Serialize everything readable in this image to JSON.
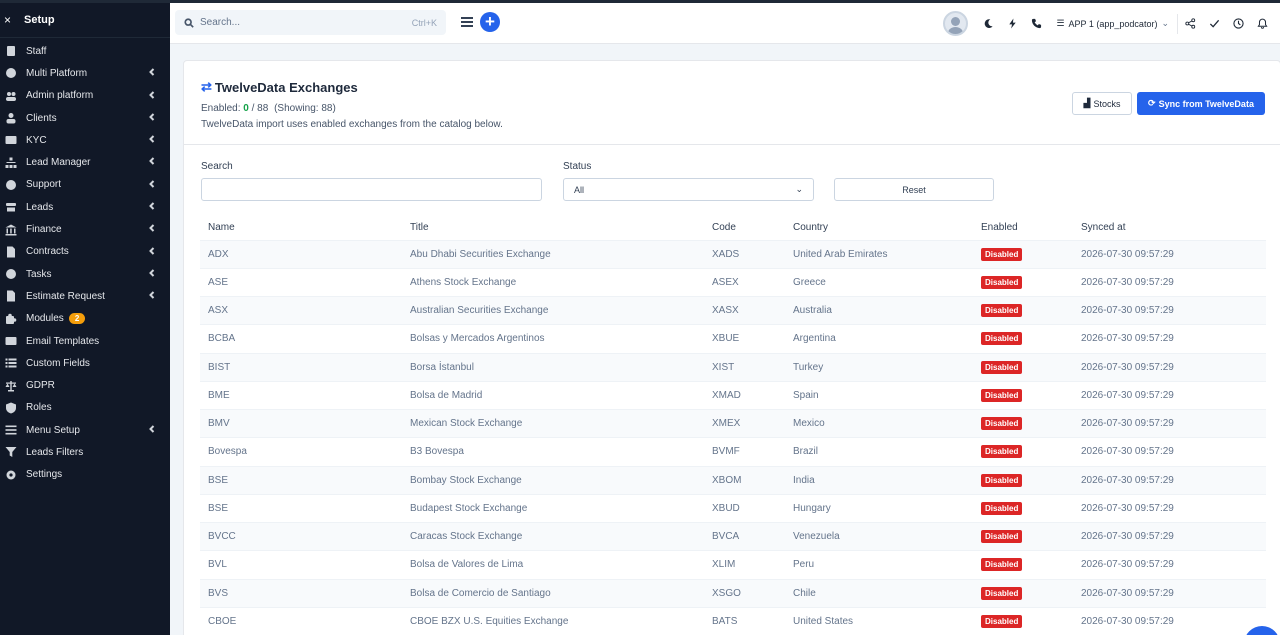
{
  "sidebar": {
    "close_glyph": "×",
    "title": "Setup",
    "items": [
      {
        "label": "Staff",
        "icon": "staff-icon",
        "chevron": false
      },
      {
        "label": "Multi Platform",
        "icon": "globe-icon",
        "chevron": true
      },
      {
        "label": "Admin platform",
        "icon": "users-icon",
        "chevron": true
      },
      {
        "label": "Clients",
        "icon": "user-icon",
        "chevron": true
      },
      {
        "label": "KYC",
        "icon": "id-card-icon",
        "chevron": true
      },
      {
        "label": "Lead Manager",
        "icon": "sitemap-icon",
        "chevron": true
      },
      {
        "label": "Support",
        "icon": "life-ring-icon",
        "chevron": true
      },
      {
        "label": "Leads",
        "icon": "tty-icon",
        "chevron": true
      },
      {
        "label": "Finance",
        "icon": "bank-icon",
        "chevron": true
      },
      {
        "label": "Contracts",
        "icon": "file-icon",
        "chevron": true
      },
      {
        "label": "Tasks",
        "icon": "check-circle-icon",
        "chevron": true
      },
      {
        "label": "Estimate Request",
        "icon": "file-outline-icon",
        "chevron": true
      },
      {
        "label": "Modules",
        "icon": "puzzle-icon",
        "chevron": false,
        "badge": "2"
      },
      {
        "label": "Email Templates",
        "icon": "envelope-icon",
        "chevron": false
      },
      {
        "label": "Custom Fields",
        "icon": "list-icon",
        "chevron": false
      },
      {
        "label": "GDPR",
        "icon": "scale-icon",
        "chevron": false
      },
      {
        "label": "Roles",
        "icon": "shield-icon",
        "chevron": false
      },
      {
        "label": "Menu Setup",
        "icon": "bars-icon",
        "chevron": true
      },
      {
        "label": "Leads Filters",
        "icon": "filter-icon",
        "chevron": false
      },
      {
        "label": "Settings",
        "icon": "gear-icon",
        "chevron": false
      }
    ]
  },
  "topbar": {
    "search_placeholder": "Search...",
    "search_shortcut": "Ctrl+K",
    "app_selector": "APP 1 (app_podcator)"
  },
  "page": {
    "title": "TwelveData Exchanges",
    "enabled_label": "Enabled:",
    "enabled_count": "0",
    "enabled_total": "/ 88",
    "showing": "(Showing: 88)",
    "description": "TwelveData import uses enabled exchanges from the catalog below.",
    "stocks_button": "Stocks",
    "sync_button": "Sync from TwelveData"
  },
  "filters": {
    "search_label": "Search",
    "search_value": "",
    "status_label": "Status",
    "status_value": "All",
    "reset_button": "Reset"
  },
  "table": {
    "headers": [
      "Name",
      "Title",
      "Code",
      "Country",
      "Enabled",
      "Synced at"
    ],
    "rows": [
      {
        "name": "ADX",
        "title": "Abu Dhabi Securities Exchange",
        "code": "XADS",
        "country": "United Arab Emirates",
        "enabled": "Disabled",
        "synced": "2026-07-30 09:57:29"
      },
      {
        "name": "ASE",
        "title": "Athens Stock Exchange",
        "code": "ASEX",
        "country": "Greece",
        "enabled": "Disabled",
        "synced": "2026-07-30 09:57:29"
      },
      {
        "name": "ASX",
        "title": "Australian Securities Exchange",
        "code": "XASX",
        "country": "Australia",
        "enabled": "Disabled",
        "synced": "2026-07-30 09:57:29"
      },
      {
        "name": "BCBA",
        "title": "Bolsas y Mercados Argentinos",
        "code": "XBUE",
        "country": "Argentina",
        "enabled": "Disabled",
        "synced": "2026-07-30 09:57:29"
      },
      {
        "name": "BIST",
        "title": "Borsa İstanbul",
        "code": "XIST",
        "country": "Turkey",
        "enabled": "Disabled",
        "synced": "2026-07-30 09:57:29"
      },
      {
        "name": "BME",
        "title": "Bolsa de Madrid",
        "code": "XMAD",
        "country": "Spain",
        "enabled": "Disabled",
        "synced": "2026-07-30 09:57:29"
      },
      {
        "name": "BMV",
        "title": "Mexican Stock Exchange",
        "code": "XMEX",
        "country": "Mexico",
        "enabled": "Disabled",
        "synced": "2026-07-30 09:57:29"
      },
      {
        "name": "Bovespa",
        "title": "B3 Bovespa",
        "code": "BVMF",
        "country": "Brazil",
        "enabled": "Disabled",
        "synced": "2026-07-30 09:57:29"
      },
      {
        "name": "BSE",
        "title": "Bombay Stock Exchange",
        "code": "XBOM",
        "country": "India",
        "enabled": "Disabled",
        "synced": "2026-07-30 09:57:29"
      },
      {
        "name": "BSE",
        "title": "Budapest Stock Exchange",
        "code": "XBUD",
        "country": "Hungary",
        "enabled": "Disabled",
        "synced": "2026-07-30 09:57:29"
      },
      {
        "name": "BVCC",
        "title": "Caracas Stock Exchange",
        "code": "BVCA",
        "country": "Venezuela",
        "enabled": "Disabled",
        "synced": "2026-07-30 09:57:29"
      },
      {
        "name": "BVL",
        "title": "Bolsa de Valores de Lima",
        "code": "XLIM",
        "country": "Peru",
        "enabled": "Disabled",
        "synced": "2026-07-30 09:57:29"
      },
      {
        "name": "BVS",
        "title": "Bolsa de Comercio de Santiago",
        "code": "XSGO",
        "country": "Chile",
        "enabled": "Disabled",
        "synced": "2026-07-30 09:57:29"
      },
      {
        "name": "CBOE",
        "title": "CBOE BZX U.S. Equities Exchange",
        "code": "BATS",
        "country": "United States",
        "enabled": "Disabled",
        "synced": "2026-07-30 09:57:29"
      }
    ]
  },
  "colors": {
    "sidebar_bg": "#111827",
    "primary": "#2563eb",
    "disabled_badge": "#dc2626",
    "enabled_count": "#16a34a",
    "module_badge": "#f59e0b"
  }
}
